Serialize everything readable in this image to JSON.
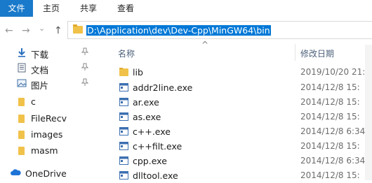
{
  "ribbon": {
    "tabs": [
      "文件",
      "主页",
      "共享",
      "查看"
    ]
  },
  "nav": {
    "back": "←",
    "forward": "→",
    "recent": "⌄",
    "up": "↑"
  },
  "address": {
    "path": "D:\\Application\\dev\\Dev-Cpp\\MinGW64\\bin"
  },
  "sidebar": {
    "items": [
      {
        "label": "下载",
        "icon": "download-icon",
        "pinned": true
      },
      {
        "label": "文档",
        "icon": "document-icon",
        "pinned": true
      },
      {
        "label": "图片",
        "icon": "picture-icon",
        "pinned": true
      },
      {
        "label": "c",
        "icon": "folder-icon",
        "pinned": false
      },
      {
        "label": "FileRecv",
        "icon": "folder-icon",
        "pinned": false
      },
      {
        "label": "images",
        "icon": "folder-icon",
        "pinned": false
      },
      {
        "label": "masm",
        "icon": "folder-icon",
        "pinned": false
      },
      {
        "label": "OneDrive",
        "icon": "cloud-icon",
        "pinned": false
      }
    ],
    "pin_glyph": "📌"
  },
  "list": {
    "sort_indicator": "^",
    "columns": {
      "name": "名称",
      "date": "修改日期"
    },
    "rows": [
      {
        "name": "lib",
        "date": "2019/10/20 21:",
        "type": "folder"
      },
      {
        "name": "addr2line.exe",
        "date": "2014/12/8 15:",
        "type": "exe"
      },
      {
        "name": "ar.exe",
        "date": "2014/12/8 15:",
        "type": "exe"
      },
      {
        "name": "as.exe",
        "date": "2014/12/8 15:",
        "type": "exe"
      },
      {
        "name": "c++.exe",
        "date": "2014/12/8 6:34",
        "type": "exe"
      },
      {
        "name": "c++filt.exe",
        "date": "2014/12/8 15:",
        "type": "exe"
      },
      {
        "name": "cpp.exe",
        "date": "2014/12/8 6:34",
        "type": "exe"
      },
      {
        "name": "dlltool.exe",
        "date": "2014/12/8 15:",
        "type": "exe"
      }
    ]
  },
  "colors": {
    "accent": "#1979ca",
    "selection": "#0078d7",
    "folder": "#f0c24a"
  }
}
